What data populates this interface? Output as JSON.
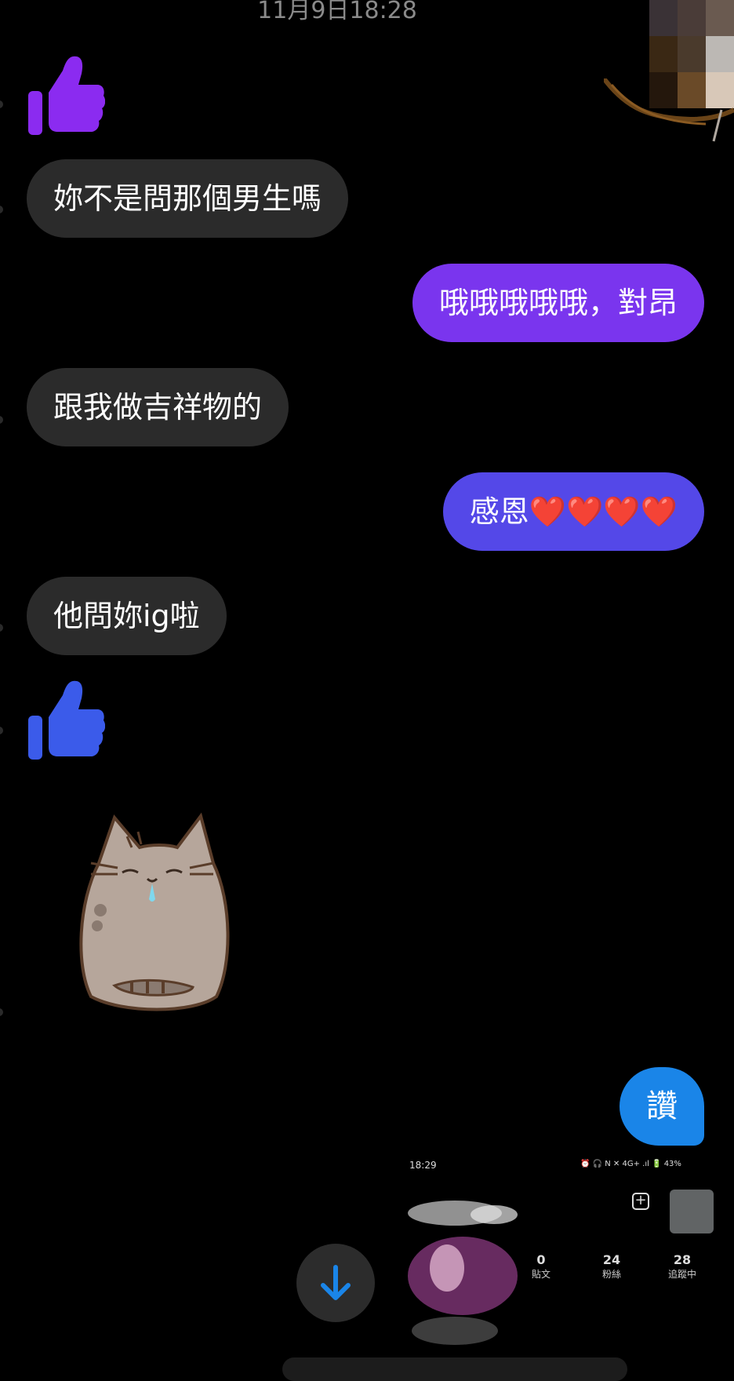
{
  "timestamp": "11月9日18:28",
  "messages": {
    "m1": "妳不是問那個男生嗎",
    "m2": "哦哦哦哦哦，對昂",
    "m3": "跟我做吉祥物的",
    "m4": "感恩❤️❤️❤️❤️",
    "m5": "他問妳ig啦",
    "m6": "讚"
  },
  "colors": {
    "incoming": "#2b2b2b",
    "outgoing_purple": "#7a35ee",
    "outgoing_indigo": "#5448e8",
    "like_bubble": "#1a85e8",
    "thumb_purple": "#8b2bf0",
    "thumb_blue": "#3b5bea"
  },
  "icons": {
    "thumb1": "thumbs-up-icon",
    "thumb2": "thumbs-up-icon",
    "sticker": "pusheen-cat-sticker",
    "scroll": "arrow-down-icon"
  },
  "screenshot": {
    "time": "18:29",
    "status": "⏰ 🎧 N ✕ 4G+ .ıl 🔋 43%",
    "stats": [
      {
        "value": "0",
        "label": "貼文"
      },
      {
        "value": "24",
        "label": "粉絲"
      },
      {
        "value": "28",
        "label": "追蹤中"
      }
    ]
  }
}
